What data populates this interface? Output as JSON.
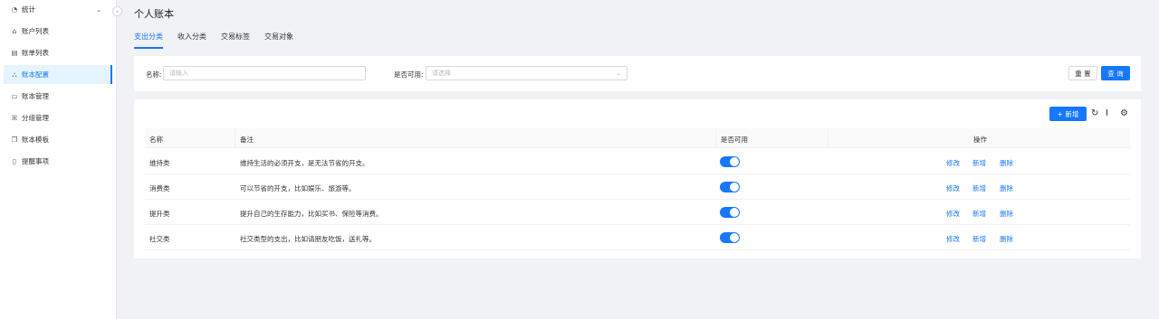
{
  "sidebar": {
    "items": [
      {
        "label": "统计",
        "icon": "chart-pie-icon"
      },
      {
        "label": "账户列表",
        "icon": "bank-icon"
      },
      {
        "label": "账单列表",
        "icon": "bill-icon"
      },
      {
        "label": "账本配置",
        "icon": "cluster-icon"
      },
      {
        "label": "账本管理",
        "icon": "folder-icon"
      },
      {
        "label": "分组管理",
        "icon": "team-icon"
      },
      {
        "label": "账本模板",
        "icon": "copy-icon"
      },
      {
        "label": "提醒事项",
        "icon": "reminder-icon"
      }
    ],
    "active_index": 3
  },
  "header": {
    "title": "个人账本",
    "tabs": [
      "支出分类",
      "收入分类",
      "交易标签",
      "交易对象"
    ],
    "active_tab": 0
  },
  "filter": {
    "name_label": "名称:",
    "name_placeholder": "请输入",
    "enabled_label": "是否可用:",
    "enabled_placeholder": "请选择",
    "reset_label": "重 置",
    "query_label": "查 询"
  },
  "table": {
    "add_label": "+ 新增",
    "columns": [
      "名称",
      "备注",
      "是否可用",
      "操作"
    ],
    "rows": [
      {
        "name": "维持类",
        "remark": "维持生活的必须开支，是无法节省的开支。",
        "enabled": true
      },
      {
        "name": "消费类",
        "remark": "可以节省的开支，比如娱乐、旅游等。",
        "enabled": true
      },
      {
        "name": "提升类",
        "remark": "提升自己的生存能力，比如买书、保险等消费。",
        "enabled": true
      },
      {
        "name": "社交类",
        "remark": "社交类型的支出，比如请朋友吃饭，送礼等。",
        "enabled": true
      }
    ],
    "actions": {
      "edit": "修改",
      "add": "新增",
      "delete": "删除"
    }
  },
  "colors": {
    "accent": "#1677ff",
    "background": "#f0f2f5"
  }
}
